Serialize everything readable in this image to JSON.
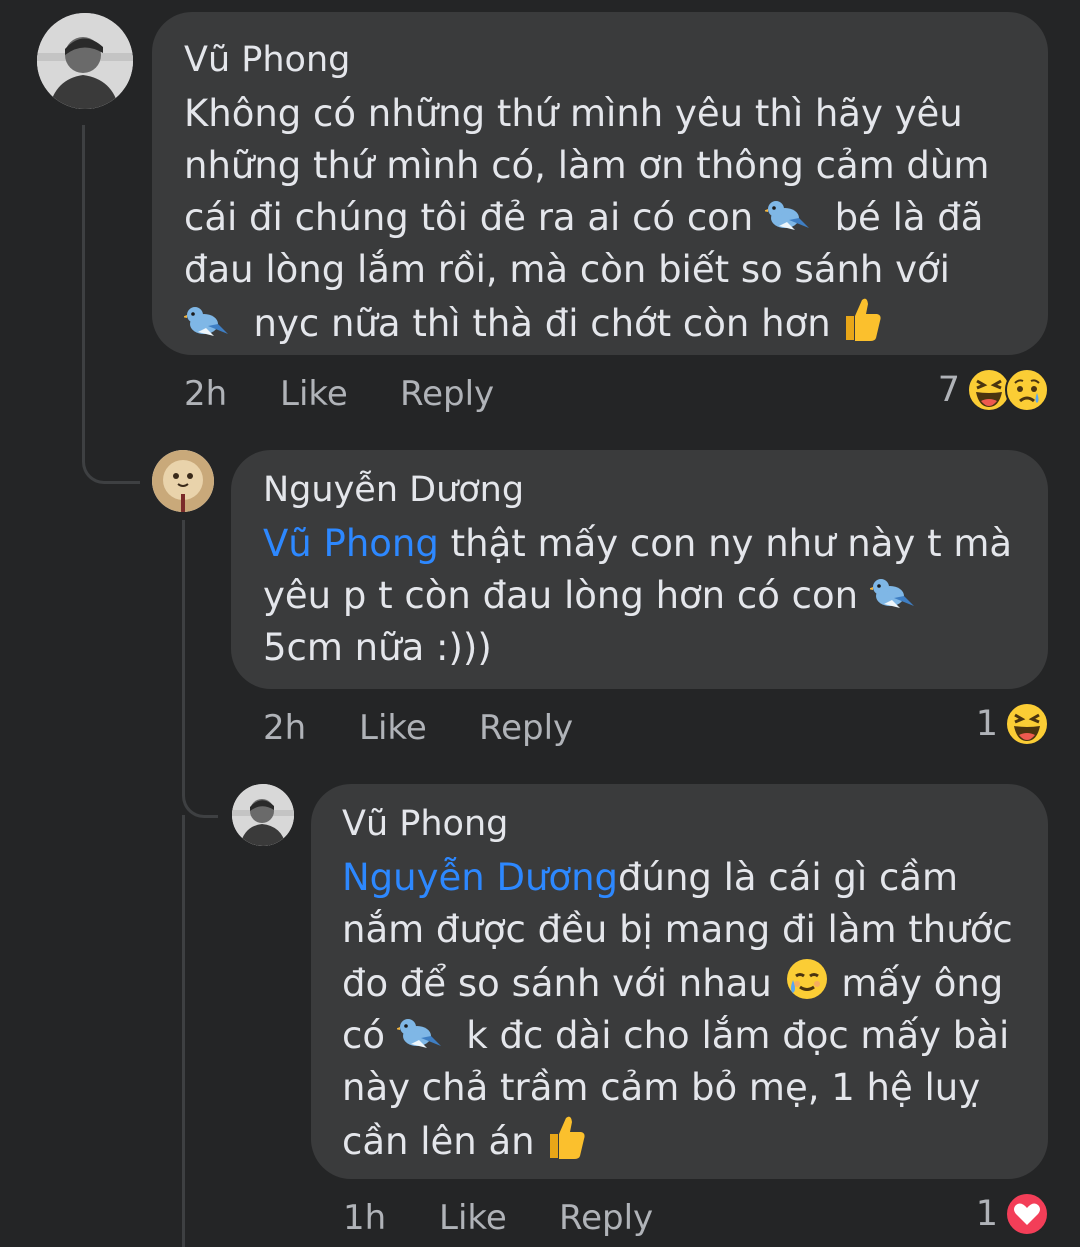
{
  "comments": [
    {
      "author": "Vũ Phong",
      "lines": [
        "Không có những thứ mình yêu thì hãy yêu",
        "những thứ mình có, làm ơn thông cảm dùm",
        "cái đi chúng tôi đẻ ra ai có con",
        "bé là đã",
        "đau lòng lắm rồi, mà còn biết so sánh với",
        "nyc nữa thì thà đi chớt còn hơn"
      ],
      "time": "2h",
      "like_label": "Like",
      "reply_label": "Reply",
      "reaction_count": "7",
      "reactions": [
        "haha-icon",
        "sad-icon"
      ]
    },
    {
      "author": "Nguyễn Dương",
      "mention": "Vũ Phong",
      "lines": [
        " thật mấy con ny như này t mà",
        "yêu p t còn đau lòng hơn có con",
        "5cm nữa :)))"
      ],
      "time": "2h",
      "like_label": "Like",
      "reply_label": "Reply",
      "reaction_count": "1",
      "reactions": [
        "haha-icon"
      ]
    },
    {
      "author": "Vũ Phong",
      "mention": "Nguyễn Dương",
      "lines": [
        "đúng là cái gì cầm",
        "nắm được đều bị mang đi làm thước",
        "đo để so sánh với nhau",
        "mấy ông",
        "có",
        "k đc dài cho lắm đọc mấy bài",
        "này chả trầm cảm bỏ mẹ, 1 hệ luỵ",
        "cần lên án"
      ],
      "time": "1h",
      "like_label": "Like",
      "reply_label": "Reply",
      "reaction_count": "1",
      "reactions": [
        "love-icon"
      ]
    }
  ],
  "colors": {
    "background": "#242526",
    "bubble": "#3a3b3c",
    "mention": "#2d88ff",
    "secondary_text": "#b0b3b8"
  }
}
